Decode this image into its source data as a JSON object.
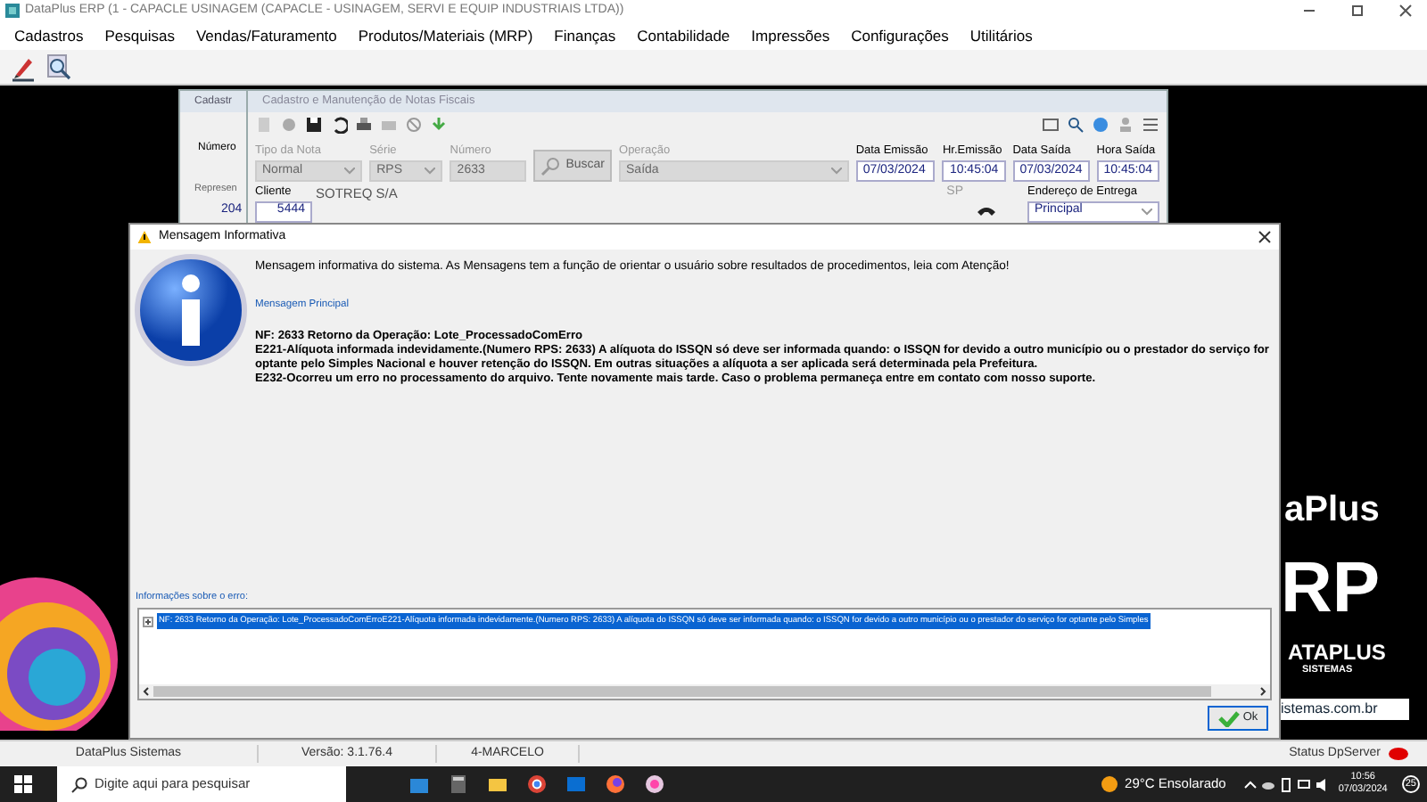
{
  "app_window": {
    "title": "DataPlus ERP (1 - CAPACLE USINAGEM   (CAPACLE - USINAGEM, SERVI E EQUIP INDUSTRIAIS LTDA))"
  },
  "menu": [
    "Cadastros",
    "Pesquisas",
    "Vendas/Faturamento",
    "Produtos/Materiais (MRP)",
    "Finanças",
    "Contabilidade",
    "Impressões",
    "Configurações",
    "Utilitários"
  ],
  "wallpaper": {
    "texts": [
      "aPlus",
      "RP",
      "ATAPLUS",
      "SISTEMAS",
      "istemas.com.br"
    ]
  },
  "back_window": {
    "title": "Cadastr",
    "labels": [
      "Número",
      "Represen"
    ],
    "value": "204"
  },
  "nf_window": {
    "title": "Cadastro e Manutenção de Notas Fiscais",
    "fields": [
      {
        "label": "Tipo da Nota",
        "value": "Normal",
        "kind": "select",
        "disabled": true
      },
      {
        "label": "Série",
        "value": "RPS",
        "kind": "select",
        "disabled": true
      },
      {
        "label": "Número",
        "value": "2633",
        "kind": "number",
        "disabled": true
      },
      {
        "label": "Buscar",
        "kind": "button",
        "disabled": true
      },
      {
        "label": "Operação",
        "value": "Saída",
        "kind": "select",
        "disabled": true
      },
      {
        "label": "Data Emissão",
        "value": "07/03/2024",
        "kind": "text",
        "disabled": false
      },
      {
        "label": "Hr.Emissão",
        "value": "10:45:04",
        "kind": "text",
        "disabled": false
      },
      {
        "label": "Data Saída",
        "value": "07/03/2024",
        "kind": "text",
        "disabled": false
      },
      {
        "label": "Hora Saída",
        "value": "10:45:04",
        "kind": "text",
        "disabled": false
      }
    ],
    "cliente": {
      "label": "Cliente",
      "code": "5444",
      "name": "SOTREQ S/A",
      "uf": "SP"
    },
    "endereco": {
      "label": "Endereço de Entrega",
      "value": "Principal"
    }
  },
  "dialog": {
    "title": "Mensagem Informativa",
    "intro": "Mensagem informativa do sistema. As Mensagens tem a função de orientar o usuário sobre resultados de procedimentos, leia com Atenção!",
    "link": "Mensagem Principal",
    "messages": [
      "NF: 2633 Retorno da Operação: Lote_ProcessadoComErro",
      "E221-Alíquota informada indevidamente.(Numero RPS: 2633) A alíquota do ISSQN só deve ser informada quando: o ISSQN for devido a outro município ou o prestador do serviço for optante pelo Simples Nacional e houver retenção do ISSQN. Em outras situações a alíquota a ser aplicada será determinada pela Prefeitura.",
      "E232-Ocorreu um erro no processamento do arquivo. Tente novamente mais tarde. Caso o problema permaneça entre em contato com nosso suporte."
    ],
    "details_label": "Informações sobre o erro:",
    "tree": [
      {
        "text": "NF: 2633 Retorno da Operação: Lote_ProcessadoComErroE221-Alíquota informada indevidamente.(Numero RPS: 2633) A alíquota do ISSQN só deve ser informada quando: o ISSQN for devido a outro município ou o prestador do serviço for optante pelo Simples",
        "selected": true,
        "expanded": false
      }
    ],
    "ok": "Ok"
  },
  "status_bar": {
    "cells": [
      "DataPlus Sistemas",
      "Versão: 3.1.76.4",
      "4-MARCELO"
    ],
    "server": "Status DpServer"
  },
  "taskbar": {
    "search_placeholder": "Digite aqui para pesquisar",
    "weather": "29°C  Ensolarado",
    "time": "10:56",
    "date": "07/03/2024",
    "notifications": "25"
  }
}
